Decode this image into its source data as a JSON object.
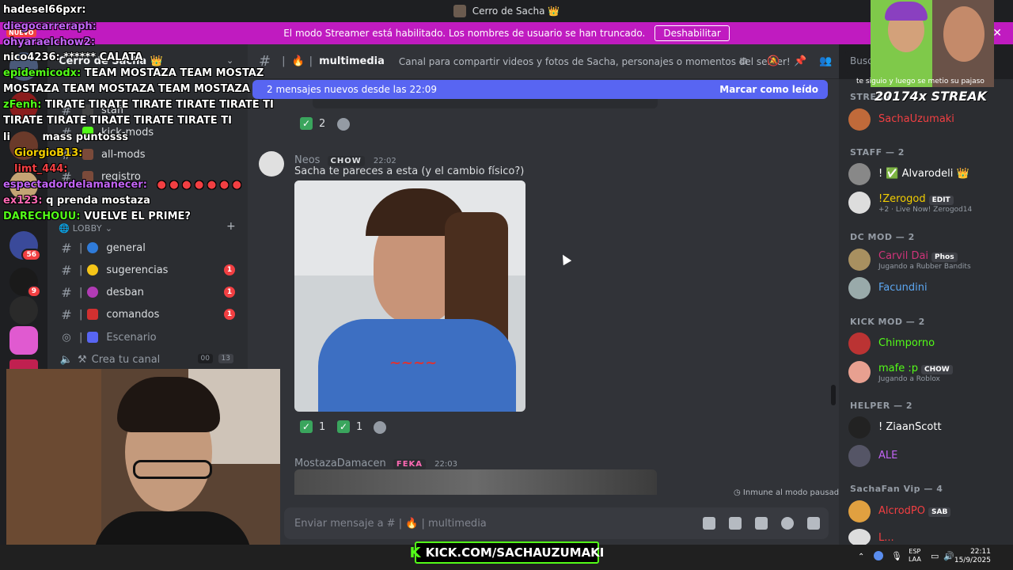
{
  "window": {
    "title": "Cerro de Sacha 👑"
  },
  "banner": {
    "text": "El modo Streamer está habilitado. Los nombres de usuario se han truncado.",
    "button": "Deshabilitar",
    "close": "✕"
  },
  "server_sidebar": {
    "nuevo_label": "NUEVO",
    "badges": [
      "56",
      "9"
    ]
  },
  "channels": {
    "server_name": "Cerro de Sacha 👑",
    "items_top": [
      {
        "label": "staff"
      },
      {
        "label": "kick-mods"
      },
      {
        "label": "all-mods"
      },
      {
        "label": "registro"
      }
    ],
    "lobby_label": "LOBBY",
    "items": [
      {
        "label": "general",
        "emoji_color": "#2f7bd9"
      },
      {
        "label": "sugerencias",
        "emoji_color": "#f5c518",
        "unread": "1"
      },
      {
        "label": "desban",
        "emoji_color": "#b13bb5",
        "unread": "1"
      },
      {
        "label": "comandos",
        "emoji_color": "#d13030",
        "unread": "1"
      }
    ],
    "stage": "Escenario",
    "create": "Crea tu canal",
    "create_counts": [
      "00",
      "13"
    ]
  },
  "header": {
    "channel_name": "multimedia",
    "topic": "Canal para compartir videos y fotos de Sacha, personajes o momentos del server!",
    "search_placeholder": "Busca"
  },
  "main": {
    "new_messages": "2 mensajes nuevos desde las 22:09",
    "mark_read": "Marcar como leído",
    "top_reaction_count": "2",
    "message1": {
      "author": "Neos",
      "tag": "CHOW",
      "time": "22:02",
      "text": "Sacha te pareces a esta (y el cambio físico?)",
      "reactions": [
        "1",
        "1"
      ]
    },
    "message2": {
      "author": "MostazaDamacen",
      "tag": "FEKA",
      "time": "22:03"
    },
    "paused": "Inmune al modo pausado",
    "composer_placeholder": "Enviar mensaje a # | 🔥 | multimedia"
  },
  "members": {
    "groups": [
      {
        "title": "STREAM",
        "rows": [
          {
            "name": "SachaUzumaki",
            "color": "#f23f42"
          }
        ]
      },
      {
        "title": "STAFF — 2",
        "rows": [
          {
            "name": "! ✅ Alvarodeli 👑",
            "color": "#ffffff"
          },
          {
            "name": "!Zerogod",
            "color": "#f2cd00",
            "pill": "EDIT",
            "sub": "+2 · Live Now! Zerogod14"
          }
        ]
      },
      {
        "title": "DC MOD — 2",
        "rows": [
          {
            "name": "Carvil Dai",
            "color": "#d0347a",
            "pill": "Phos",
            "sub": "Jugando a Rubber Bandits"
          },
          {
            "name": "Facundini",
            "color": "#5ca7f2"
          }
        ]
      },
      {
        "title": "KICK MOD — 2",
        "rows": [
          {
            "name": "Chimporno",
            "color": "#53fc18"
          },
          {
            "name": "mafe :p",
            "color": "#53fc18",
            "pill": "CHOW",
            "sub": "Jugando a Roblox"
          }
        ]
      },
      {
        "title": "HELPER — 2",
        "rows": [
          {
            "name": "! ZiaanScott",
            "color": "#ffffff"
          },
          {
            "name": "ALE",
            "color": "#c264f5"
          }
        ]
      },
      {
        "title": "SachaFan Vip — 4",
        "rows": [
          {
            "name": "AlcrodPO",
            "color": "#f23f42",
            "pill": "SAB"
          },
          {
            "name": "L...",
            "color": "#f23f42"
          }
        ]
      }
    ]
  },
  "overlay": {
    "chat": [
      {
        "user": "hadesel66pxr:",
        "text": "",
        "color": "#ffffff"
      },
      {
        "user": "diegocarreraph:",
        "text": "",
        "color": "#c264f5"
      },
      {
        "user": "ohyaraelchow2:",
        "text": "",
        "color": "#c264f5"
      },
      {
        "user": "nico4236:",
        "text": "****** CALATA",
        "color": "#ffffff"
      },
      {
        "user": "epidemicodx:",
        "text": "TEAM MOSTAZA TEAM MOSTAZ",
        "color": "#53fc18"
      },
      {
        "user": "",
        "text": "MOSTAZA TEAM MOSTAZA TEAM MOSTAZA",
        "color": "#ffffff"
      },
      {
        "user": "zFenh:",
        "text": "TIRATE TIRATE TIRATE TIRATE TIRATE TI",
        "color": "#53fc18"
      },
      {
        "user": "",
        "text": "TIRATE TIRATE TIRATE TIRATE TIRATE TI",
        "color": "#ffffff"
      },
      {
        "user": "li",
        "text": "mass puntosss",
        "color": "#ffffff"
      },
      {
        "user": "GiorgioB13:",
        "text": "",
        "color": "#f2cd00"
      },
      {
        "user": "limt_444:",
        "text": "",
        "color": "#f23f42"
      },
      {
        "user": "espectadordelamanecer:",
        "text": "",
        "color": "#c264f5"
      },
      {
        "user": "ex123:",
        "text": "q prenda mostaza",
        "color": "#ff69b4"
      },
      {
        "user": "DARECHOUU:",
        "text": "VUELVE EL PRIME?",
        "color": "#53fc18"
      }
    ],
    "streak": "20174x STREAK",
    "streak_sub": "te siguio y luego se metio su pajaso"
  },
  "taskbar": {
    "kick_url": "KICK.COM/SACHAUZUMAKI",
    "lang": [
      "ESP",
      "LAA"
    ],
    "time": "22:11",
    "date": "15/9/2025"
  },
  "colors": {
    "blurple": "#5865f2",
    "streamer": "#c01bc0",
    "kick": "#53fc18",
    "unread": "#f23f42"
  }
}
